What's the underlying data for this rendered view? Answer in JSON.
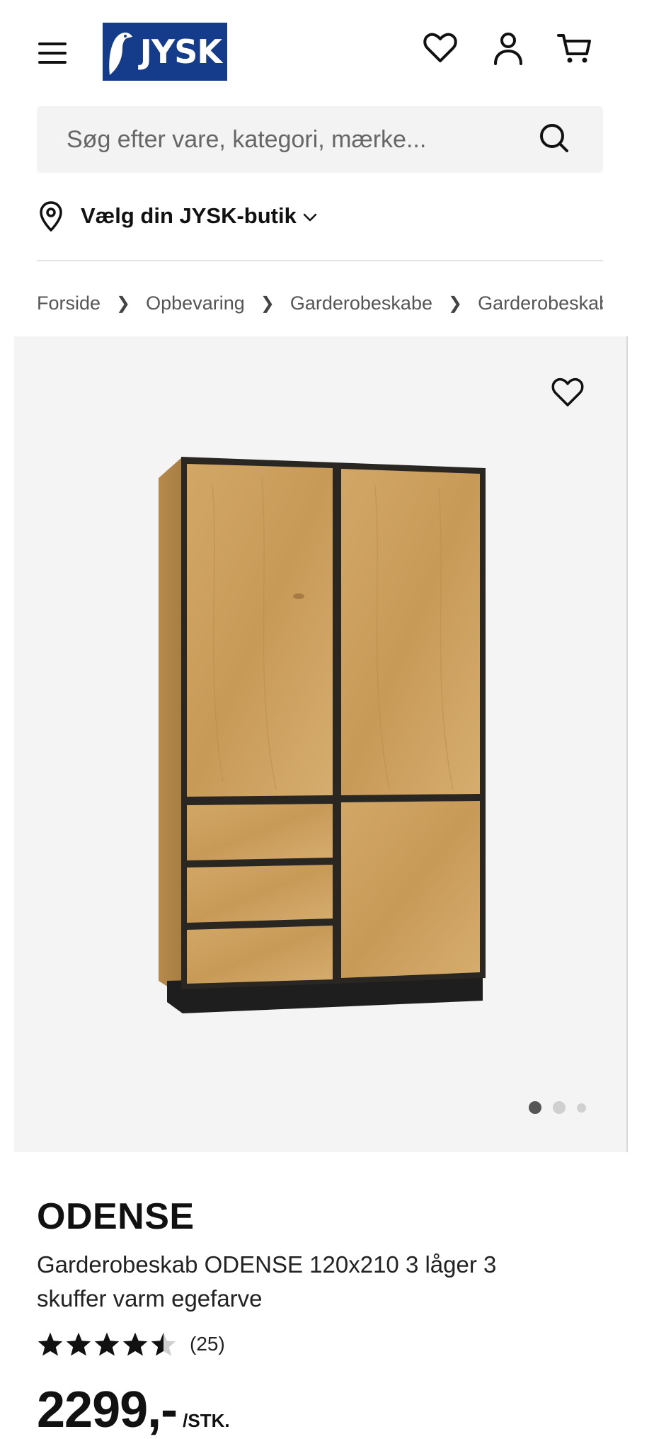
{
  "header": {
    "logo_text": "JYSK",
    "brand_color": "#143c8a"
  },
  "search": {
    "placeholder": "Søg efter vare, kategori, mærke..."
  },
  "store": {
    "label": "Vælg din JYSK-butik"
  },
  "breadcrumb": [
    "Forside",
    "Opbevaring",
    "Garderobeskabe",
    "Garderobeskab ODENSE"
  ],
  "gallery": {
    "image_count": 3,
    "active_index": 0
  },
  "product": {
    "brand": "ODENSE",
    "title": "Garderobeskab ODENSE 120x210 3 låger 3 skuffer varm egefarve",
    "rating_value": 4.5,
    "rating_count": "(25)",
    "price": "2299,-",
    "price_unit": "/STK."
  }
}
